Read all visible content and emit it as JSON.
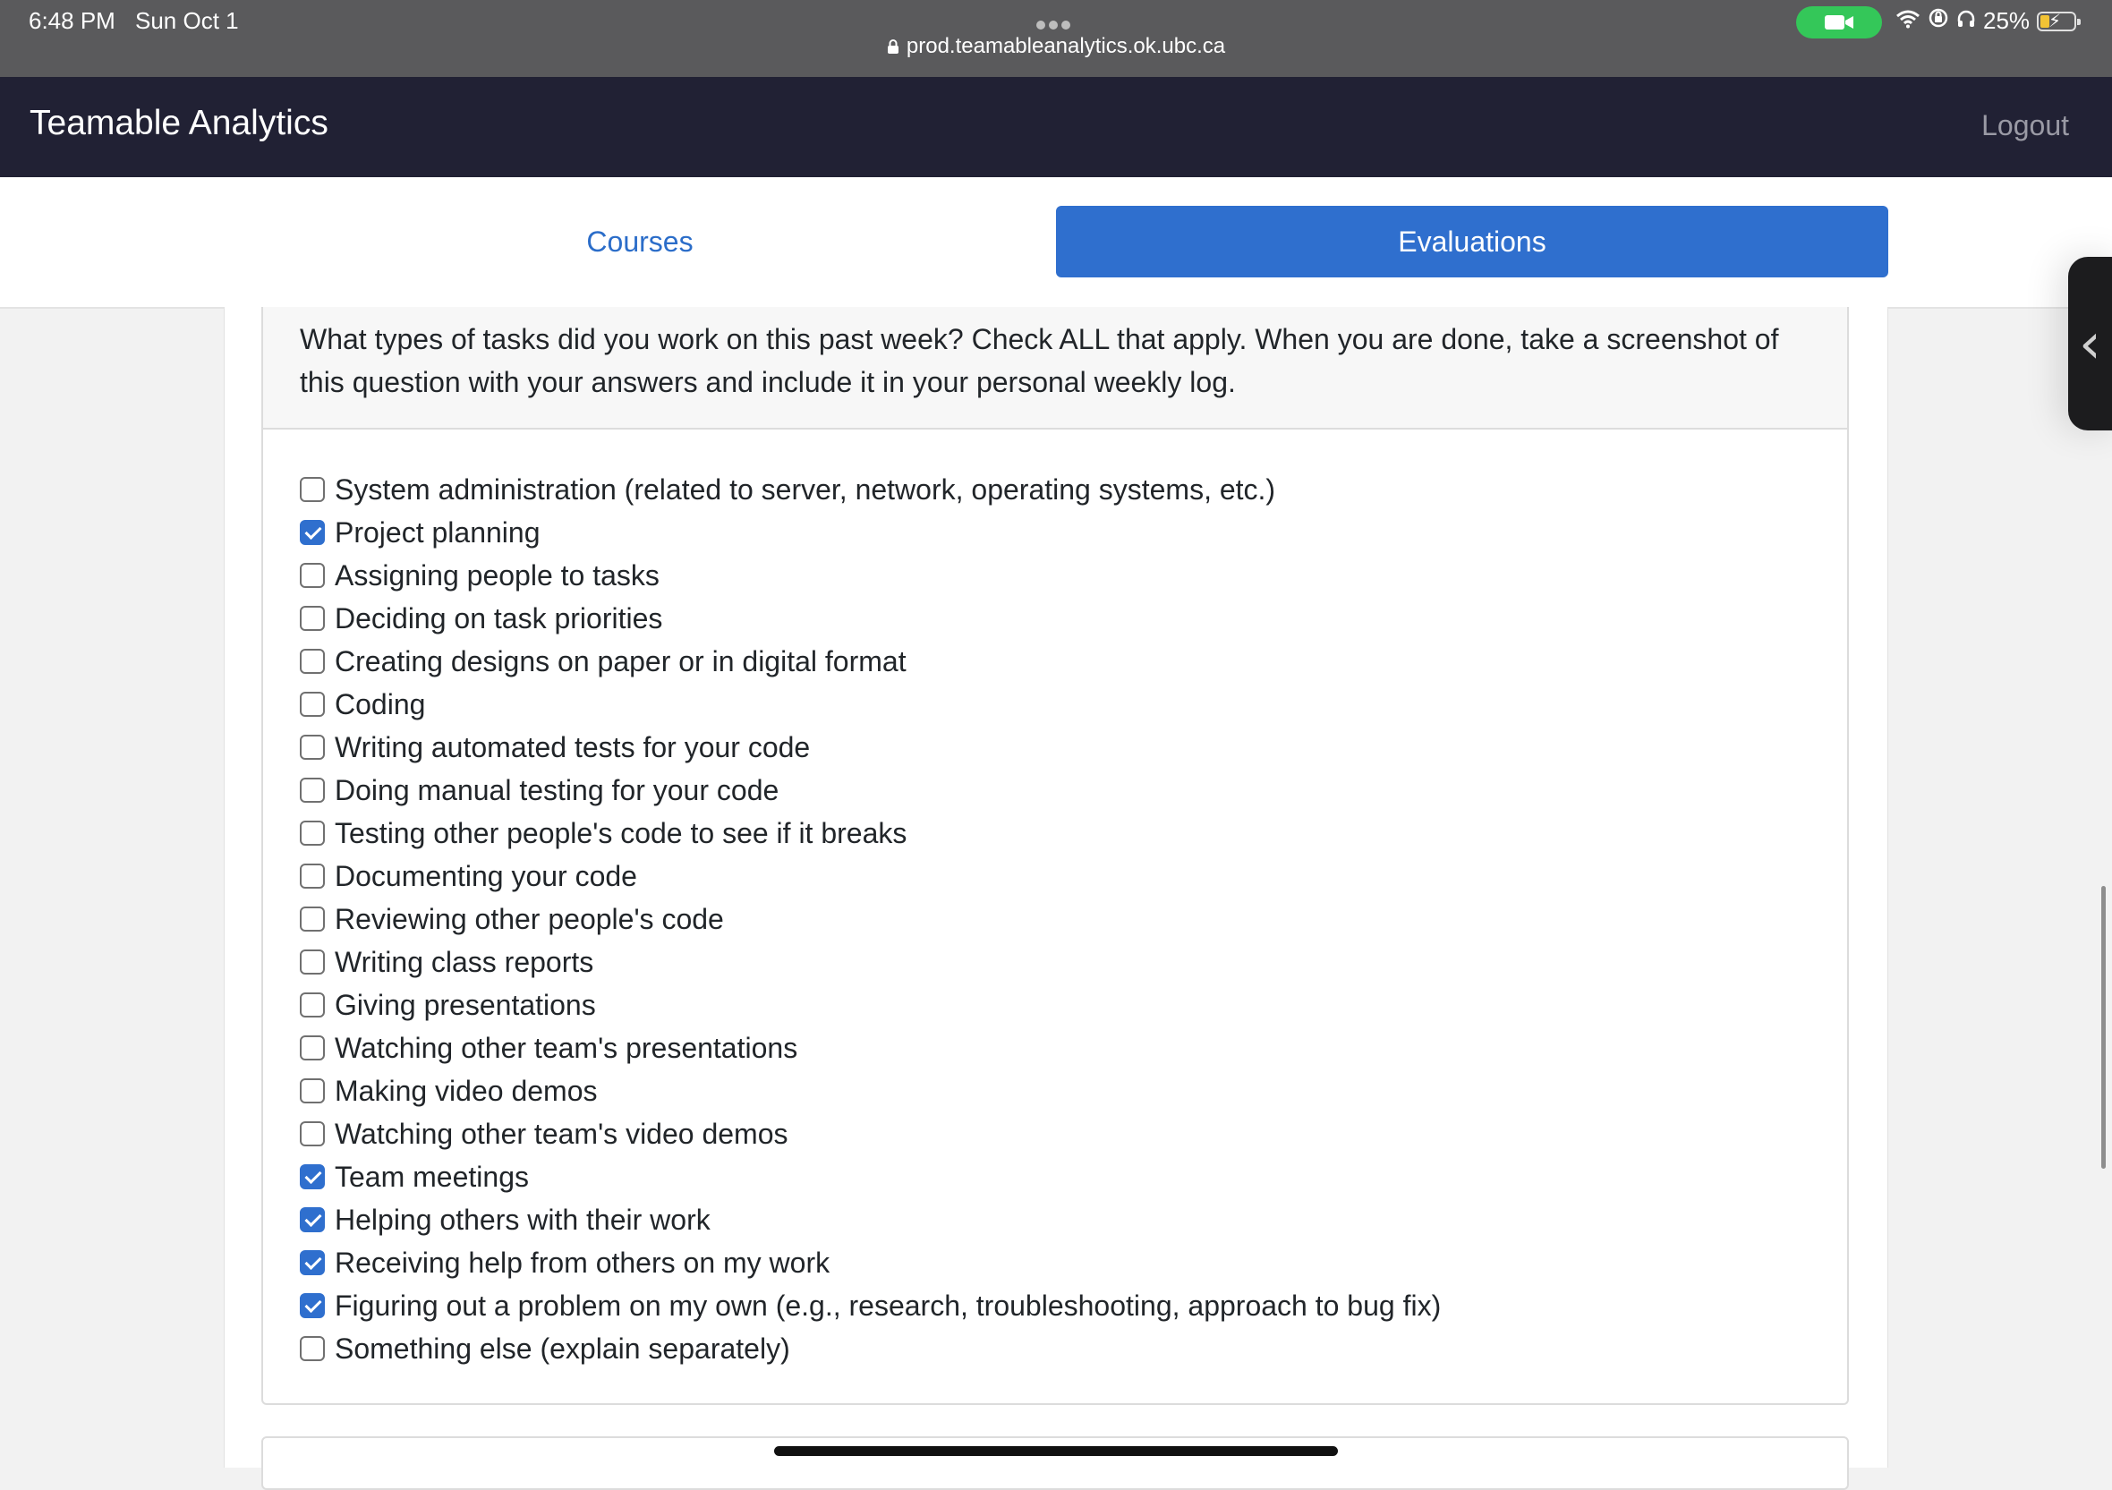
{
  "status_bar": {
    "time": "6:48 PM",
    "date": "Sun Oct 1",
    "url": "prod.teamableanalytics.ok.ubc.ca",
    "battery": "25%",
    "battery_level": 0.25
  },
  "navbar": {
    "brand": "Teamable Analytics",
    "logout": "Logout"
  },
  "tabs": {
    "courses": "Courses",
    "evaluations": "Evaluations",
    "active": "evaluations"
  },
  "question": {
    "text": "What types of tasks did you work on this past week? Check ALL that apply. When you are done, take a screenshot of this question with your answers and include it in your personal weekly log.",
    "options": [
      {
        "label": "System administration (related to server, network, operating systems, etc.)",
        "checked": false
      },
      {
        "label": "Project planning",
        "checked": true
      },
      {
        "label": "Assigning people to tasks",
        "checked": false
      },
      {
        "label": "Deciding on task priorities",
        "checked": false
      },
      {
        "label": "Creating designs on paper or in digital format",
        "checked": false
      },
      {
        "label": "Coding",
        "checked": false
      },
      {
        "label": "Writing automated tests for your code",
        "checked": false
      },
      {
        "label": "Doing manual testing for your code",
        "checked": false
      },
      {
        "label": "Testing other people's code to see if it breaks",
        "checked": false
      },
      {
        "label": "Documenting your code",
        "checked": false
      },
      {
        "label": "Reviewing other people's code",
        "checked": false
      },
      {
        "label": "Writing class reports",
        "checked": false
      },
      {
        "label": "Giving presentations",
        "checked": false
      },
      {
        "label": "Watching other team's presentations",
        "checked": false
      },
      {
        "label": "Making video demos",
        "checked": false
      },
      {
        "label": "Watching other team's video demos",
        "checked": false
      },
      {
        "label": "Team meetings",
        "checked": true
      },
      {
        "label": "Helping others with their work",
        "checked": true
      },
      {
        "label": "Receiving help from others on my work",
        "checked": true
      },
      {
        "label": "Figuring out a problem on my own (e.g., research, troubleshooting, approach to bug fix)",
        "checked": true
      },
      {
        "label": "Something else (explain separately)",
        "checked": false
      }
    ]
  },
  "colors": {
    "navbar_bg": "#212134",
    "accent": "#2f6fce",
    "status_bar_bg": "#5a5a5c"
  }
}
